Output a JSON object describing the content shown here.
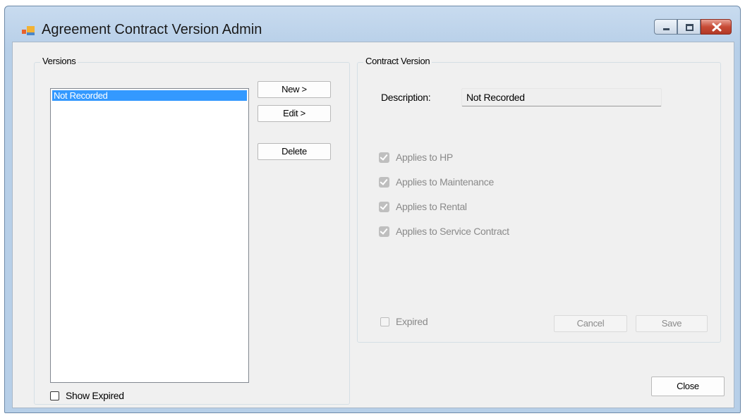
{
  "window": {
    "title": "Agreement Contract Version Admin",
    "icon": "application-icon",
    "controls": [
      "minimize-icon",
      "maximize-icon",
      "close-icon"
    ]
  },
  "versions": {
    "group_title": "Versions",
    "items": [
      "Not Recorded"
    ],
    "selected_item": "Not Recorded",
    "new_button": "New >",
    "edit_button": "Edit >",
    "delete_button": "Delete",
    "show_expired_label": "Show Expired",
    "show_expired_checked": false
  },
  "contract_version": {
    "group_title": "Contract Version",
    "description_label": "Description:",
    "description_value": "Not Recorded",
    "applies": [
      {
        "label": "Applies to HP",
        "checked": true
      },
      {
        "label": "Applies to Maintenance",
        "checked": true
      },
      {
        "label": "Applies to Rental",
        "checked": true
      },
      {
        "label": "Applies to Service Contract",
        "checked": true
      }
    ],
    "expired_label": "Expired",
    "expired_checked": false,
    "cancel_button": "Cancel",
    "save_button": "Save"
  },
  "footer": {
    "close_button": "Close"
  },
  "colors": {
    "selection": "#3399ff",
    "client_background": "#f0f0f0",
    "title_bar": "#b7cfe8",
    "close_button": "#c74b36"
  }
}
